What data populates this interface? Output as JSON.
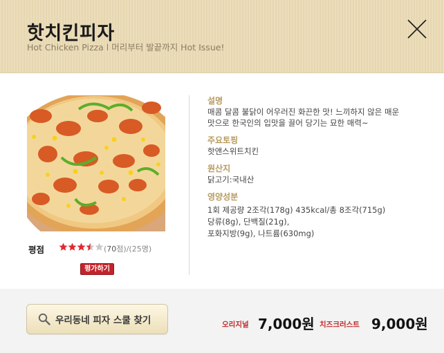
{
  "header": {
    "title": "핫치킨피자",
    "subtitle": "Hot Chicken Pizza l 머리부터 발끝까지 Hot Issue!"
  },
  "rating": {
    "label": "평점",
    "score_stars": 3.5,
    "max_stars": 5,
    "count_prefix": "(",
    "count": "70",
    "count_unit": "점",
    "count_suffix": ")/(25명)",
    "rate_button": "평가하기",
    "star_color": "#e4282f"
  },
  "info": {
    "description_head": "설명",
    "description_line1": "매콤 달콤 불닭이 어우러진 화끈한 맛! 느끼하지 않은 매운",
    "description_line2": "맛으로 한국인의 입맛을 끌어 당기는 묘한 매력~",
    "topping_head": "주요토핑",
    "topping": "핫앤스위트치킨",
    "origin_head": "원산지",
    "origin": "닭고기:국내산",
    "nutrition_head": "영양성분",
    "nutrition_line1": "1회 제공량 2조각(178g) 435kcal/총 8조각(715g)",
    "nutrition_line2": "당류(8g), 단백질(21g),",
    "nutrition_line3": "포화지방(9g), 나트륨(630mg)"
  },
  "footer": {
    "search_button": "우리동네 피자 스쿨 찾기",
    "original_label": "오리지널",
    "original_price": "7,000원",
    "cheese_label": "치즈크러스트",
    "cheese_price": "9,000원"
  },
  "icons": {
    "close": "close-icon",
    "search": "search-icon"
  }
}
